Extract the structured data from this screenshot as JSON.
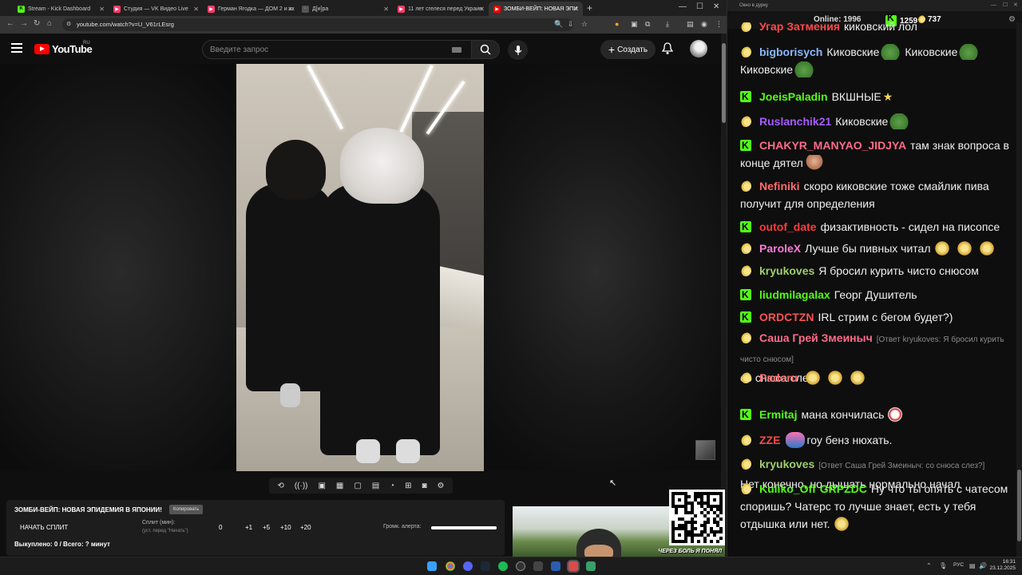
{
  "browser": {
    "tabs": [
      {
        "title": "Stream - Kick Dashboard",
        "color": "#53fc18",
        "glyph": "K"
      },
      {
        "title": "Студия — VK Видео Live",
        "color": "#ff3b6b",
        "glyph": "▶"
      },
      {
        "title": "Герман Ягодка — ДОМ 2 и ак",
        "color": "#ff3b6b",
        "glyph": "▶"
      },
      {
        "title": "Д[и]ра",
        "color": "#555555",
        "glyph": "◦"
      },
      {
        "title": "11 лет сгелеся перед Украин",
        "color": "#ff3b6b",
        "glyph": "▶"
      },
      {
        "title": "ЗОМБИ-ВЕЙП: НОВАЯ ЭПИ",
        "color": "#ff0000",
        "glyph": "▶"
      }
    ],
    "url": "youtube.com/watch?v=U_V61rLEsrg"
  },
  "youtube": {
    "logo_text": "YouTube",
    "country": "RU",
    "search_placeholder": "Введите запрос",
    "create_label": "Создать"
  },
  "split_panel": {
    "title": "ЗОМБИ-ВЕЙП: НОВАЯ ЭПИДЕМИЯ В ЯПОНИИ!",
    "copy_label": "Копировать",
    "start_label": "НАЧАТЬ СПЛИТ",
    "minutes_label": "Сплит (мин):",
    "minutes_hint": "(уст. перед \"Начать\")",
    "values": [
      "0",
      "+1",
      "+5",
      "+10",
      "+20"
    ],
    "volume_label": "Громк. алерта:",
    "volume_level": 1.0,
    "done_text": "Выкуплено: 0 / Всего: ? минут"
  },
  "cam": {
    "caption": "ЧЕРЕЗ БОЛЬ Я ПОНЯЛ"
  },
  "chat": {
    "window_title": "Окно в дурку",
    "online_label": "Online:",
    "online_count": "1996",
    "kick_count": "1259",
    "beer_count": "737",
    "messages": [
      {
        "badge": "beer",
        "nick": "Угар Затмения",
        "color": "#ff4a4a",
        "text": "киковский лол"
      },
      {
        "badge": "beer",
        "nick": "bigborisych",
        "color": "#8ab8ff",
        "text": "Киковские",
        "emotes": [
          "pepe"
        ],
        "text2": "Киковские",
        "emotes2": [
          "pepe"
        ],
        "text3": "Киковские",
        "emotes3": [
          "pepe"
        ]
      },
      {
        "badge": "k",
        "nick": "JoeisPaladin",
        "color": "#53fc18",
        "text": "ВКШНЫЕ",
        "emotes": [
          "star"
        ]
      },
      {
        "badge": "beer",
        "nick": "Ruslanchik21",
        "color": "#a65bff",
        "text": "Киковские",
        "emotes": [
          "pepe"
        ]
      },
      {
        "badge": "k",
        "nick": "CHAKYR_MANYAO_JIDJYA",
        "color": "#ff6b8a",
        "text": "там знак вопроса в конце дятел",
        "emotes": [
          "face"
        ]
      },
      {
        "badge": "beer",
        "nick": "Nefiniki",
        "color": "#ff6b6b",
        "text": "скоро киковские тоже смайлик пива получит для определения"
      },
      {
        "badge": "k",
        "nick": "outof_date",
        "color": "#ff3b3b",
        "text": "физактивность - сидел на писопсе"
      },
      {
        "badge": "beer",
        "nick": "ParoleX",
        "color": "#ff7ad9",
        "text": "Лучше бы пивных читал",
        "emotes": [
          "beer",
          "beer",
          "beer"
        ]
      },
      {
        "badge": "beer",
        "nick": "kryukoves",
        "color": "#9ecf6b",
        "text": "Я бросил курить чисто снюсом"
      },
      {
        "badge": "k",
        "nick": "liudmilagalax",
        "color": "#53fc18",
        "text": "Георг Душитель"
      },
      {
        "badge": "k",
        "nick": "ORDCTZN",
        "color": "#ff5252",
        "text": "IRL стрим с бегом будет?)"
      },
      {
        "badge": "beer",
        "nick": "Саша Грей Змеиныч",
        "color": "#ff6b8a",
        "reply": "[Ответ kryukoves: Я бросил курить чисто снюсом]",
        "text": "со снюса слез?"
      },
      {
        "badge": "beer",
        "nick": "Padoru",
        "color": "#ff6b6b",
        "text": "",
        "emotes": [
          "beer",
          "beer",
          "beer"
        ]
      },
      {
        "badge": "k",
        "nick": "Ermitaj",
        "color": "#53fc18",
        "text": "мана кончилась",
        "emotes": [
          "troll"
        ]
      },
      {
        "badge": "beer",
        "nick": "ZZE",
        "color": "#ff4a4a",
        "text": "гоу бенз нюхать.",
        "emotes_before": [
          "pink"
        ]
      },
      {
        "badge": "beer",
        "nick": "kryukoves",
        "color": "#9ecf6b",
        "reply": "[Ответ Саша Грей Змеиныч: со снюса слез?]",
        "text": "Нет конечно, но дышать нормально начал"
      },
      {
        "badge": "beer",
        "nick": "Kuliko_Off",
        "color": "#53fc18",
        "nick2": "GRPZDC",
        "text": "Ну что ты опять с чатесом споришь? Чатерс то лучше знает, есть у тебя отдышка или нет.",
        "emotes": [
          "beer"
        ]
      }
    ]
  },
  "taskbar": {
    "lang": "РУС",
    "time": "16:31",
    "date": "23.12.2025"
  }
}
